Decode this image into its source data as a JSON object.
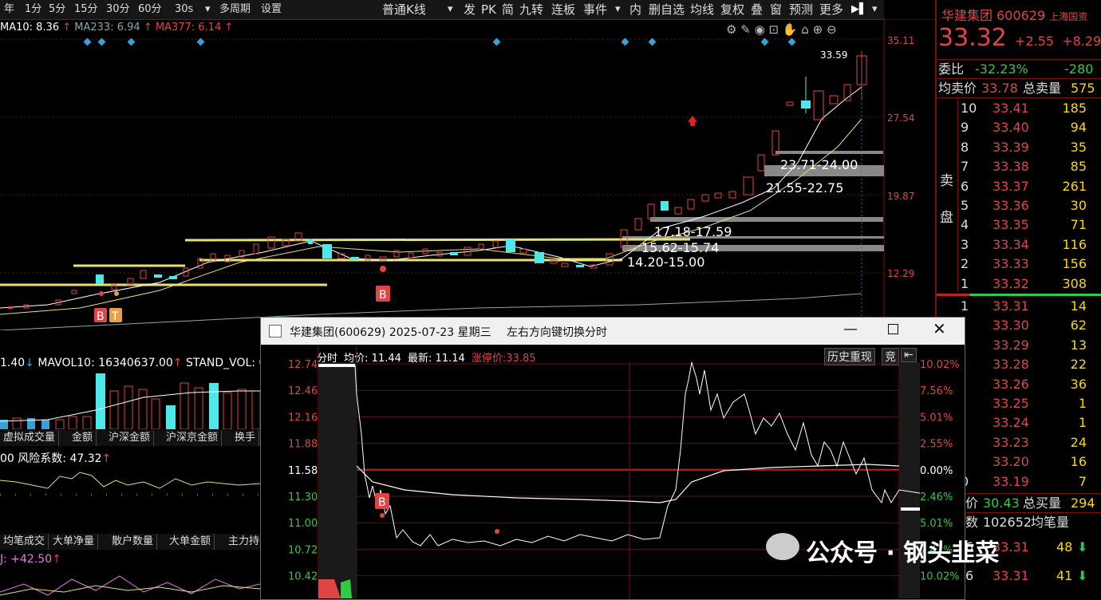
{
  "toolbar": {
    "items": [
      "年",
      "1分",
      "5分",
      "15分",
      "30分",
      "60分",
      "30s",
      "▾",
      "多周期",
      "设置"
    ],
    "kline_type": "普通K线",
    "kline_dropdown": "▾",
    "right_items": [
      "发",
      "PK",
      "简",
      "九转",
      "连板",
      "事件",
      "▾",
      "内",
      "删自选",
      "均线",
      "复权",
      "叠",
      "窗",
      "预测",
      "更多"
    ],
    "expand_icon": "▶▌",
    "menu_icon": "▾"
  },
  "ma_line": {
    "ma10": "MA10: 8.36",
    "ma233": "MA233: 6.94",
    "ma377": "MA377: 6.14",
    "arrow": "↑"
  },
  "price_axis": [
    "35.11",
    "27.54",
    "19.87",
    "12.29"
  ],
  "annotations": {
    "high": "33.59",
    "zone1": "23.71-24.00",
    "zone2": "21.55-22.75",
    "zone3": "17.18-17.59",
    "zone4": "15.62-15.74",
    "zone5": "14.20-15.00",
    "b_marker": "B",
    "t_marker": "T"
  },
  "volume_line": {
    "prefix": "1.40",
    "mavol": "MAVOL10: 16340637.00",
    "std": "STAND_VOL: 0"
  },
  "tabs_row1": [
    "虚拟成交量",
    "金额",
    "沪深金额",
    "沪深京金额",
    "换手"
  ],
  "risk_line": {
    "prefix": "00",
    "label": "风险系数: 47.32"
  },
  "tabs_row2": [
    "均笔成交",
    "大单净量",
    "散户数量",
    "大单金额",
    "主力持"
  ],
  "j_line": "J: +42.50",
  "stock": {
    "name": "华建集团",
    "code": "600629",
    "tag": "上海国资",
    "price": "33.32",
    "change": "+2.55",
    "pct": "+8.29%",
    "weibi_label": "委比",
    "weibi": "-32.23%",
    "weicha": "-280",
    "avg_label": "均卖价",
    "avg": "33.78",
    "total_label": "总卖量",
    "total": "575"
  },
  "sell_label": [
    "卖",
    "盘"
  ],
  "asks": [
    {
      "lvl": "10",
      "px": "33.41",
      "vol": "185"
    },
    {
      "lvl": "9",
      "px": "33.40",
      "vol": "94"
    },
    {
      "lvl": "8",
      "px": "33.39",
      "vol": "35"
    },
    {
      "lvl": "7",
      "px": "33.38",
      "vol": "85"
    },
    {
      "lvl": "6",
      "px": "33.37",
      "vol": "261"
    },
    {
      "lvl": "5",
      "px": "33.36",
      "vol": "30"
    },
    {
      "lvl": "4",
      "px": "33.35",
      "vol": "71"
    },
    {
      "lvl": "3",
      "px": "33.34",
      "vol": "116"
    },
    {
      "lvl": "2",
      "px": "33.33",
      "vol": "156"
    },
    {
      "lvl": "1",
      "px": "33.32",
      "vol": "308"
    }
  ],
  "bids": [
    {
      "lvl": "1",
      "px": "33.31",
      "vol": "14"
    },
    {
      "lvl": "",
      "px": "33.30",
      "vol": "62"
    },
    {
      "lvl": "",
      "px": "33.29",
      "vol": "13"
    },
    {
      "lvl": "",
      "px": "33.28",
      "vol": "22"
    },
    {
      "lvl": "",
      "px": "33.26",
      "vol": "36"
    },
    {
      "lvl": "",
      "px": "33.25",
      "vol": "1"
    },
    {
      "lvl": "",
      "px": "33.24",
      "vol": "1"
    },
    {
      "lvl": "",
      "px": "33.23",
      "vol": "24"
    },
    {
      "lvl": "",
      "px": "33.20",
      "vol": "16"
    },
    {
      "lvl": "0",
      "px": "33.19",
      "vol": "7"
    }
  ],
  "bottom_right": {
    "avgbuy_label": "价",
    "avgbuy": "30.43",
    "buytotal_label": "总买量",
    "buytotal": "294",
    "count_label": "数",
    "count": "102652",
    "avgbi_label": "均笔量",
    "row1_px": "33.31",
    "row1_vol": "48",
    "row1_lvl": "6",
    "row2_px": "33.31",
    "row2_vol": "41",
    "row2_lvl": "6"
  },
  "popup": {
    "title": "华建集团(600629) 2025-07-23 星期三",
    "hint": "左右方向键切换分时",
    "line_label": "分时",
    "avg_label": "均价: 11.44",
    "last_label": "最新: 11.14",
    "limit_label": "涨停价:33.85",
    "history_btn": "历史重现",
    "jing_btn": "竞",
    "left_axis": [
      "12.74",
      "12.46",
      "12.16",
      "11.88",
      "11.58",
      "11.30",
      "11.00",
      "10.72",
      "10.42"
    ],
    "right_axis": [
      "10.02%",
      "7.56%",
      "5.01%",
      "2.55%",
      "0.00%",
      "2.46%",
      "5.01%",
      "7.47%",
      "10.02%"
    ],
    "b_marker": "B"
  },
  "watermark": "公众号 · 钢头韭菜"
}
